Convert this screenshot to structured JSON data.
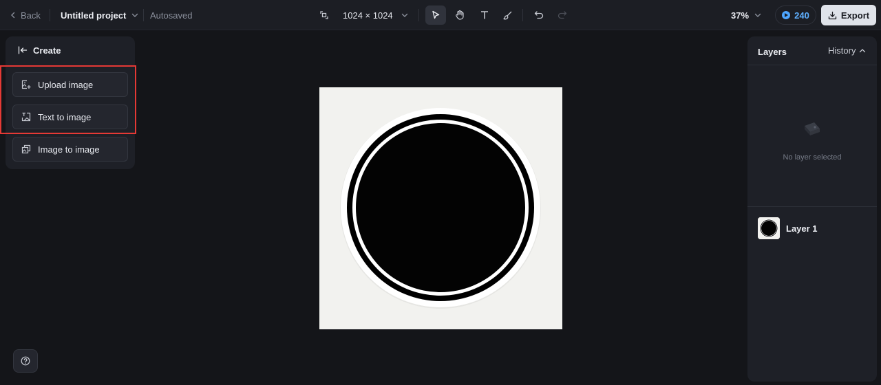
{
  "topbar": {
    "back_label": "Back",
    "project_name": "Untitled project",
    "save_status": "Autosaved",
    "canvas_size": "1024 × 1024",
    "zoom": "37%",
    "credits": "240",
    "export_label": "Export"
  },
  "tools": [
    "select-tool",
    "hand-tool",
    "text-tool",
    "brush-tool",
    "undo",
    "redo"
  ],
  "left_panel": {
    "header": "Create",
    "options": [
      {
        "label": "Upload image",
        "icon": "upload-image-icon"
      },
      {
        "label": "Text to image",
        "icon": "text-to-image-icon"
      },
      {
        "label": "Image to image",
        "icon": "image-to-image-icon"
      }
    ]
  },
  "right_panel": {
    "tab_layers": "Layers",
    "tab_history": "History",
    "empty_message": "No layer selected",
    "layers": [
      {
        "name": "Layer 1"
      }
    ]
  },
  "colors": {
    "background": "#141519",
    "panel": "#1e2027",
    "accent": "#4ea6ff",
    "highlight": "#e53935"
  }
}
